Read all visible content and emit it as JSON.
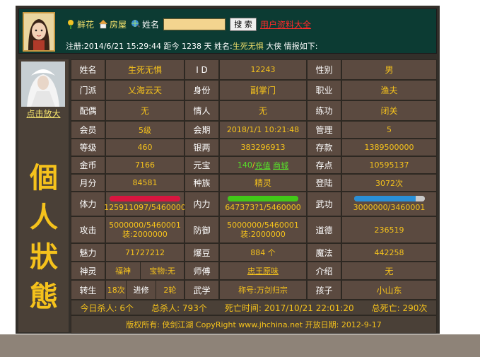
{
  "header": {
    "links": [
      "鲜花",
      "房屋"
    ],
    "name_label": "姓名",
    "search_label": "搜 索",
    "all_users_link": "用户资料大全",
    "register_line": {
      "prefix": "注册:2014/6/21 15:29:44 距今 1238 天 姓名:",
      "name": "生死无惧",
      "suffix": " 大侠 情报如下:"
    }
  },
  "left": {
    "zoom_link": "点击放大",
    "big_title": [
      "個",
      "人",
      "狀",
      "態"
    ]
  },
  "profile": {
    "name_label": "姓名",
    "name": "生死无惧",
    "id_label": "I D",
    "id": "12243",
    "gender_label": "性别",
    "gender": "男",
    "sect_label": "门派",
    "sect": "乂海云天",
    "identity_label": "身份",
    "identity": "副掌门",
    "job_label": "职业",
    "job": "渔夫",
    "spouse_label": "配偶",
    "spouse": "无",
    "lover_label": "情人",
    "lover": "无",
    "practice_label": "练功",
    "practice": "闭关",
    "member_label": "会员",
    "member": "5级",
    "member_term_label": "会期",
    "member_term": "2018/1/1 10:21:48",
    "admin_label": "管理",
    "admin": "5",
    "level_label": "等级",
    "level": "460",
    "silver_label": "银两",
    "silver": "383296913",
    "deposit_label": "存款",
    "deposit": "1389500000",
    "gold_label": "金币",
    "gold": "7166",
    "yuanbao_label": "元宝",
    "yuanbao": "140",
    "yuanbao_sep": " / ",
    "recharge_link": "充值",
    "shop_link": "商城",
    "deposit_pts_label": "存点",
    "deposit_pts": "10595137",
    "monthly_label": "月分",
    "monthly": "84581",
    "race_label": "种族",
    "race": "精灵",
    "logins_label": "登陆",
    "logins": "3072次",
    "stamina_label": "体力",
    "stamina": "125911097/5460000",
    "inner_label": "内力",
    "inner": "647373?1/5460000",
    "martial_label": "武功",
    "martial": "3000000/3460001",
    "attack_label": "攻击",
    "attack": "5000000/5460001",
    "attack_equip": "装:2000000",
    "defense_label": "防御",
    "defense": "5000000/5460001",
    "defense_equip": "装:2000000",
    "morality_label": "道德",
    "morality": "236519",
    "charm_label": "魅力",
    "charm": "71727212",
    "beans_label": "爆豆",
    "beans": "884 个",
    "magic_label": "魔法",
    "magic": "442258",
    "spirit_label": "神灵",
    "spirit": "福神",
    "treasure": "宝物:无",
    "master_label": "师傅",
    "master": "忠王原味",
    "intro_label": "介绍",
    "intro": "无",
    "rebirth_label": "转生",
    "rebirth": "18次",
    "advance_label": "进修",
    "advance": "2轮",
    "martial_study_label": "武学",
    "title": "称号:万剑归宗",
    "child_label": "孩子",
    "child": "小山东"
  },
  "summary": {
    "kills_today": "今日杀人: 6个",
    "kills_total": "总杀人: 793个",
    "death_time": "死亡时间: 2017/10/21 22:01:20",
    "deaths_total": "总死亡: 290次"
  },
  "footer": {
    "text": "版权所有: 侠剑江湖 CopyRight www.jhchina.net  开放日期: 2012-9-17"
  },
  "bars": {
    "stamina": {
      "fraction": 1.0,
      "color": "#d8163f"
    },
    "inner": {
      "fraction": 1.0,
      "color": "#41c818"
    },
    "martial": {
      "fraction": 0.87,
      "color": "#2a8fd6"
    }
  }
}
